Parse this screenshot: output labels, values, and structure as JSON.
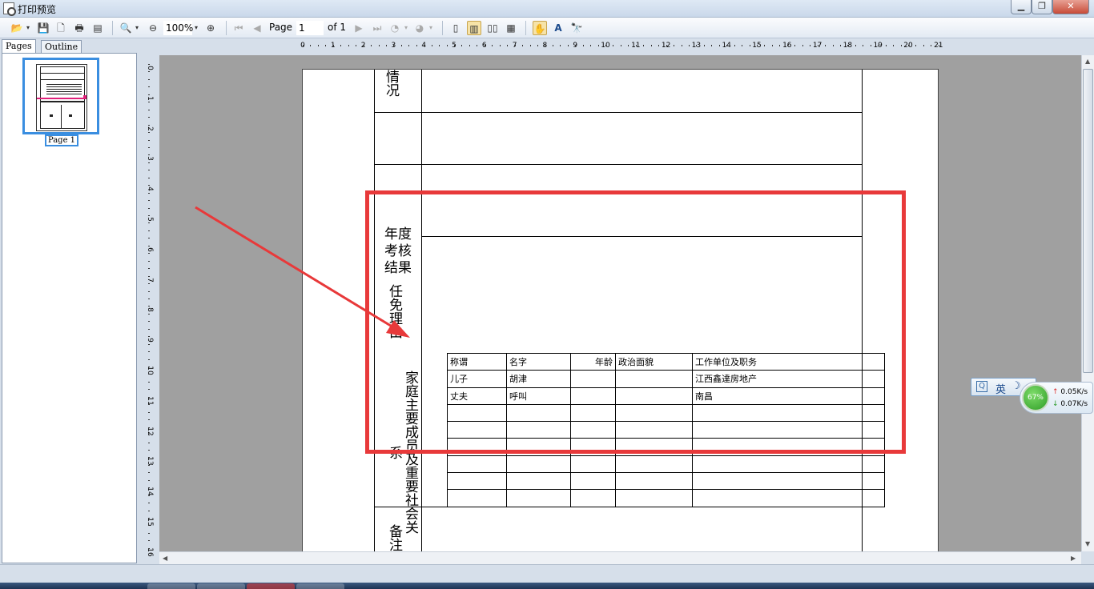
{
  "window": {
    "title": "打印预览",
    "min": "▁",
    "max": "❐",
    "close": "✕"
  },
  "toolbar": {
    "zoom": "100%",
    "page_label": "Page",
    "page_value": "1",
    "of_label": "of 1"
  },
  "left_pane": {
    "tabs": [
      "Pages",
      "Outline"
    ],
    "thumb_label": "Page 1"
  },
  "rulers": {
    "h": [
      "0",
      "1",
      "2",
      "3",
      "4",
      "5",
      "6",
      "7",
      "8",
      "9",
      "10",
      "11",
      "12",
      "13",
      "14",
      "15",
      "16",
      "17",
      "18",
      "19",
      "20",
      "21"
    ],
    "v": [
      "0",
      "1",
      "2",
      "3",
      "4",
      "5",
      "6",
      "7",
      "8",
      "9",
      "10",
      "11",
      "12",
      "13",
      "14",
      "15",
      "16"
    ]
  },
  "document": {
    "cell_top": "况",
    "cell_top2": "情",
    "kaohe": [
      "年度",
      "考核",
      "结果"
    ],
    "renmian": "任免理由",
    "family": "家庭主要成员及重要社会关系",
    "bottom_cell": "备注",
    "family_table": {
      "headers": [
        "称谓",
        "名字",
        "年龄",
        "政治面貌",
        "工作单位及职务",
        ""
      ],
      "rows": [
        [
          "儿子",
          "胡津",
          "",
          "",
          "江西鑫達房地产",
          ""
        ],
        [
          "丈夫",
          "呼叫",
          "",
          "",
          "南昌",
          ""
        ],
        [
          "",
          "",
          "",
          "",
          "",
          ""
        ],
        [
          "",
          "",
          "",
          "",
          "",
          ""
        ],
        [
          "",
          "",
          "",
          "",
          "",
          ""
        ],
        [
          "",
          "",
          "",
          "",
          "",
          ""
        ],
        [
          "",
          "",
          "",
          "",
          "",
          ""
        ],
        [
          "",
          "",
          "",
          "",
          "",
          ""
        ]
      ]
    }
  },
  "ime": {
    "lang": "英"
  },
  "net": {
    "percent": "67%",
    "up": "0.05K/s",
    "down": "0.07K/s"
  },
  "colors": {
    "annotation": "#e8393a",
    "selection": "#3a8ee0"
  }
}
